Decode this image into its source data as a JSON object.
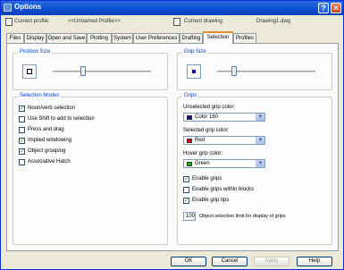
{
  "window": {
    "title": "Options",
    "help_glyph": "?",
    "close_glyph": "✕"
  },
  "profile_bar": {
    "current_profile_label": "Current profile:",
    "current_profile_value": "<<Unnamed Profile>>",
    "current_drawing_label": "Current drawing:",
    "current_drawing_value": "Drawing1.dwg"
  },
  "tabs": [
    {
      "label": "Files"
    },
    {
      "label": "Display"
    },
    {
      "label": "Open and Save"
    },
    {
      "label": "Plotting"
    },
    {
      "label": "System"
    },
    {
      "label": "User Preferences"
    },
    {
      "label": "Drafting"
    },
    {
      "label": "Selection",
      "active": true
    },
    {
      "label": "Profiles"
    }
  ],
  "pickbox": {
    "legend": "Pickbox Size",
    "level_fraction": 0.3
  },
  "grip_size": {
    "legend": "Grip Size",
    "level_fraction": 0.15
  },
  "selection_modes": {
    "legend": "Selection Modes",
    "items": [
      {
        "label": "Noun/verb selection",
        "checked": true
      },
      {
        "label": "Use Shift to add to selection",
        "checked": false
      },
      {
        "label": "Press and drag",
        "checked": false
      },
      {
        "label": "Implied windowing",
        "checked": true
      },
      {
        "label": "Object grouping",
        "checked": true
      },
      {
        "label": "Associative Hatch",
        "checked": false
      }
    ]
  },
  "grips": {
    "legend": "Grips",
    "unselected_label": "Unselected grip color:",
    "unselected_value": "Color 160",
    "unselected_color": "#1010a0",
    "selected_label": "Selected grip color:",
    "selected_value": "Red",
    "selected_color": "#e00000",
    "hover_label": "Hover grip color:",
    "hover_value": "Green",
    "hover_color": "#00c000",
    "options": [
      {
        "label": "Enable grips",
        "checked": true
      },
      {
        "label": "Enable grips within blocks",
        "checked": false
      },
      {
        "label": "Enable grip tips",
        "checked": true
      }
    ],
    "limit_value": "100",
    "limit_label": "Object selection limit for display of grips"
  },
  "buttons": {
    "ok": "OK",
    "cancel": "Cancel",
    "apply": "Apply",
    "help": "Help"
  }
}
